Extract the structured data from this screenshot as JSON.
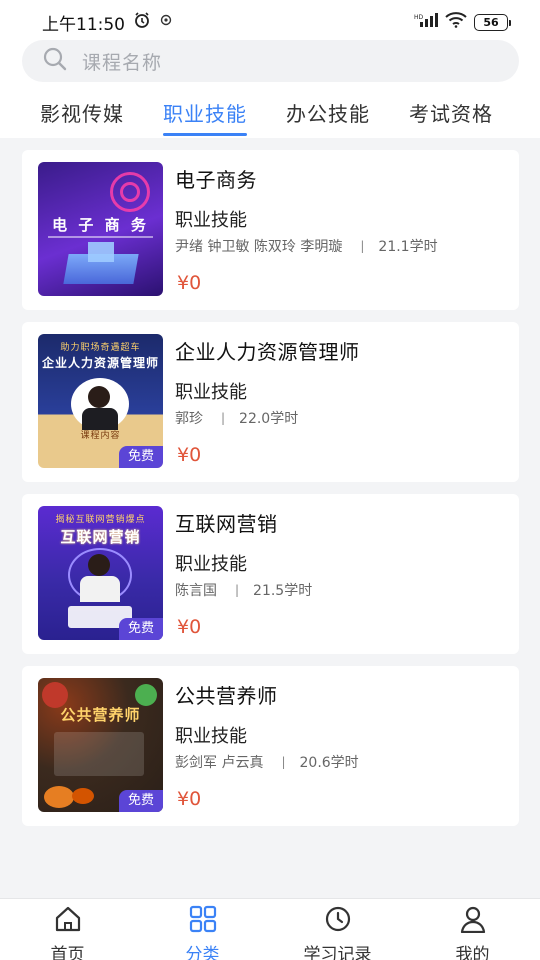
{
  "status": {
    "time": "上午11:50",
    "battery": "56"
  },
  "search": {
    "placeholder": "课程名称"
  },
  "tabs": [
    {
      "label": "影视传媒"
    },
    {
      "label": "职业技能"
    },
    {
      "label": "办公技能"
    },
    {
      "label": "考试资格"
    }
  ],
  "courses": [
    {
      "title": "电子商务",
      "category": "职业技能",
      "teachers": "尹绪 钟卫敏 陈双玲 李明璇",
      "hours": "21.1学时",
      "price": "¥0",
      "thumb_title": "电 子 商 务"
    },
    {
      "title": "企业人力资源管理师",
      "category": "职业技能",
      "teachers": "郭珍",
      "hours": "22.0学时",
      "price": "¥0",
      "thumb_title": "企业人力资源管理师",
      "thumb_sub": "助力职场奇遇超车",
      "thumb_box": "课程内容",
      "badge": "免费"
    },
    {
      "title": "互联网营销",
      "category": "职业技能",
      "teachers": "陈言国",
      "hours": "21.5学时",
      "price": "¥0",
      "thumb_title": "互联网营销",
      "thumb_sub": "揭秘互联网营销爆点",
      "badge": "免费"
    },
    {
      "title": "公共营养师",
      "category": "职业技能",
      "teachers": "彭剑军 卢云真",
      "hours": "20.6学时",
      "price": "¥0",
      "thumb_title": "公共营养师",
      "badge": "免费"
    }
  ],
  "nav": [
    {
      "label": "首页"
    },
    {
      "label": "分类"
    },
    {
      "label": "学习记录"
    },
    {
      "label": "我的"
    }
  ],
  "colors": {
    "accent": "#3b82f6",
    "price": "#e0553a"
  }
}
